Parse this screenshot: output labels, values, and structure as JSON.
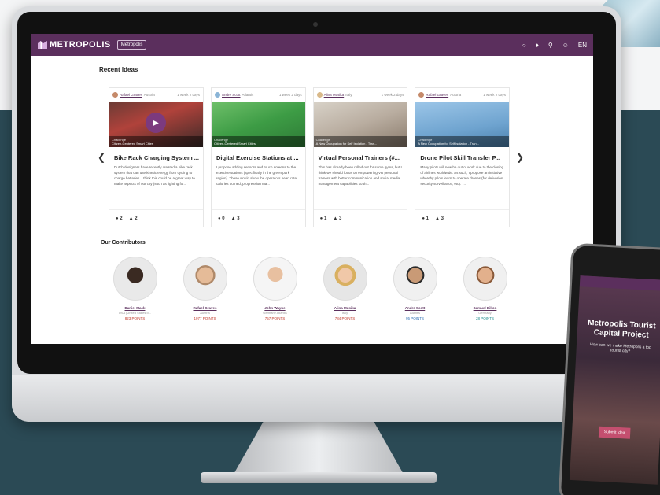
{
  "app": {
    "name": "METROPOLIS",
    "badge": "Metropolis"
  },
  "topbar": {
    "icons": [
      "chat-icon",
      "bell-icon",
      "search-icon",
      "user-icon",
      "language-toggle"
    ],
    "language": "EN"
  },
  "recent": {
    "title": "Recent Ideas",
    "cards": [
      {
        "author": "Rafael Graves",
        "location": "Austria",
        "time": "1 week 2 days",
        "img_top": "Challenge",
        "img_label": "Citizen-Centered Smart Cities",
        "title": "Bike Rack Charging System ...",
        "body": "Dutch designers have recently created a bike rack system that can use kinetic energy from cycling to charge batteries. I think this could be a great way to make aspects of our city (such as lighting for...",
        "comments": "2",
        "likes": "2"
      },
      {
        "author": "Andre Scott",
        "location": "Atlantis",
        "time": "1 week 2 days",
        "img_top": "Challenge",
        "img_label": "Citizen-Centered Smart Cities",
        "title": "Digital Exercise Stations at ...",
        "body": "I propose adding sensors and touch screens to the exercise stations (specifically in the green park region). These would show the operators heart rate, calories burned, progression ma...",
        "comments": "0",
        "likes": "3"
      },
      {
        "author": "Alina Musika",
        "location": "Italy",
        "time": "1 week 2 days",
        "img_top": "Challenge",
        "img_label": "A New Occupation for Self Isolation - Tran...",
        "title": "Virtual Personal Trainers (#...",
        "body": "This has already been rolled out for some gyms, but I think we should focus on empowering VR personal trainers with better communication and social media management capabilities so th...",
        "comments": "1",
        "likes": "3"
      },
      {
        "author": "Rafael Graves",
        "location": "Austria",
        "time": "1 week 2 days",
        "img_top": "Challenge",
        "img_label": "A New Occupation for Self Isolation - Tran...",
        "title": "Drone Pilot Skill Transfer P...",
        "body": "Many pilots will now be out of work due to the closing of airlines worldwide. As such, I propose an initiative whereby pilots learn to operate drones (for deliveries, security surveillance, etc). T...",
        "comments": "1",
        "likes": "3"
      }
    ]
  },
  "contributors": {
    "title": "Our Contributors",
    "people": [
      {
        "name": "Daniel Mack",
        "location": "USA (United States o...",
        "points": "823 POINTS"
      },
      {
        "name": "Rafael Graves",
        "location": "Austria",
        "points": "1077 POINTS"
      },
      {
        "name": "John Wayne",
        "location": "Germany Atlantis",
        "points": "757 POINTS"
      },
      {
        "name": "Alina Musika",
        "location": "Italy",
        "points": "784 POINTS"
      },
      {
        "name": "Andre Scott",
        "location": "Atlantis",
        "points": "95 POINTS"
      },
      {
        "name": "Samuel Dillon",
        "location": "Germany",
        "points": "28 POINTS"
      }
    ]
  },
  "phone": {
    "title": "Metropolis Tourist Capital Project",
    "subtitle": "How can we make Metropolis a top tourist city?",
    "button": "Submit Idea"
  },
  "colors": {
    "brand": "#5b2f5d",
    "accent": "#c0392b"
  }
}
